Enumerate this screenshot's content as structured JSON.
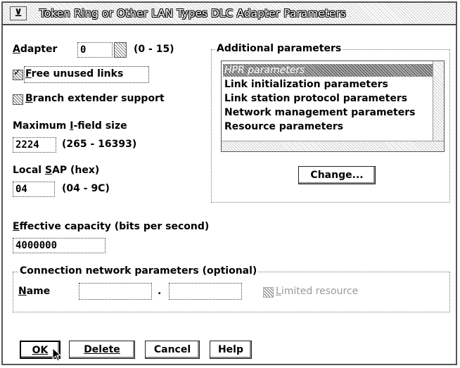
{
  "window": {
    "title": "Token Ring or Other LAN Types DLC Adapter Parameters",
    "sysmenu_symbol": "⊻"
  },
  "adapter": {
    "label_first": "A",
    "label_rest": "dapter",
    "value": "0",
    "range": "(0 - 15)"
  },
  "free_unused_links": {
    "label_first": "F",
    "label_rest": "ree unused links",
    "checked": true
  },
  "branch_extender": {
    "label_first": "B",
    "label_rest": "ranch extender support",
    "checked": false
  },
  "max_ifield": {
    "label_pre": "Maximum ",
    "label_u": "I",
    "label_post": "-field size",
    "value": "2224",
    "range": "(265 - 16393)"
  },
  "local_sap": {
    "label_pre": "Local ",
    "label_u": "S",
    "label_post": "AP (hex)",
    "value": "04",
    "range": "(04 - 9C)"
  },
  "additional": {
    "group_label": "Additional parameters",
    "items": [
      "HPR parameters",
      "Link initialization parameters",
      "Link station protocol parameters",
      "Network management parameters",
      "Resource parameters"
    ],
    "selected_index": 0,
    "change_button": "Change..."
  },
  "effective_capacity": {
    "label_first": "E",
    "label_rest": "ffective capacity (bits per second)",
    "value": "4000000"
  },
  "connection_network": {
    "group_label": "Connection network parameters (optional)",
    "name_label_first": "N",
    "name_label_rest": "ame",
    "name_part1": "",
    "separator": ".",
    "name_part2": "",
    "limited_label_first": "L",
    "limited_label_rest": "imited resource"
  },
  "buttons": {
    "ok": "OK",
    "delete": "Delete",
    "cancel": "Cancel",
    "help": "Help"
  }
}
